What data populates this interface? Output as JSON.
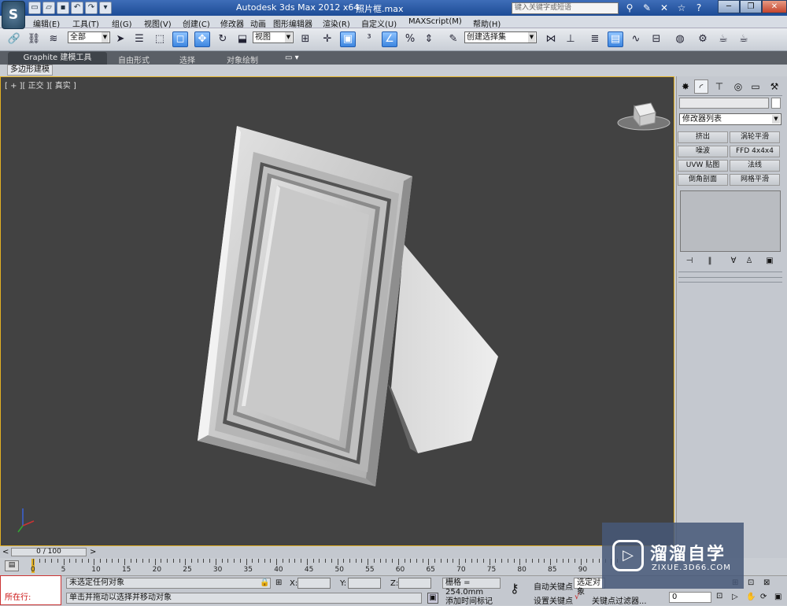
{
  "app": {
    "logo": "S",
    "title": "Autodesk 3ds Max  2012 x64",
    "file": "照片框.max"
  },
  "quick_access": [
    "new-icon",
    "open-icon",
    "save-icon",
    "undo-icon",
    "redo-icon"
  ],
  "search": {
    "placeholder": "键入关键字或短语"
  },
  "menu": [
    "编辑(E)",
    "工具(T)",
    "组(G)",
    "视图(V)",
    "创建(C)",
    "修改器",
    "动画",
    "图形编辑器",
    "渲染(R)",
    "自定义(U)",
    "MAXScript(M)",
    "帮助(H)"
  ],
  "toolbar": {
    "filter": "全部",
    "coord_system": "视图",
    "named_selection": "创建选择集"
  },
  "ribbon": {
    "tabs": [
      "Graphite 建模工具",
      "自由形式",
      "选择",
      "对象绘制"
    ],
    "subtab": "多边形建模"
  },
  "viewport": {
    "label": "[ + ][ 正交 ][ 真实 ]"
  },
  "command_panel": {
    "modifier_list": "修改器列表",
    "buttons": [
      "挤出",
      "涡轮平滑",
      "噪波",
      "FFD 4x4x4",
      "UVW 贴图",
      "法线",
      "倒角剖面",
      "网格平滑"
    ]
  },
  "timeline": {
    "frame": "0 / 100",
    "ticks": [
      "0",
      "5",
      "10",
      "15",
      "20",
      "25",
      "30",
      "35",
      "40",
      "45",
      "50",
      "55",
      "60",
      "65",
      "70",
      "75",
      "80",
      "85",
      "90"
    ]
  },
  "status": {
    "running": "所在行:",
    "selection": "未选定任何对象",
    "prompt": "单击并拖动以选择并移动对象",
    "x_label": "X:",
    "y_label": "Y:",
    "z_label": "Z:",
    "grid": "栅格 = 254.0mm",
    "add_time_tag": "添加时间标记",
    "auto_key": "自动关键点",
    "set_key": "设置关键点",
    "selected_obj": "选定对象",
    "key_filters": "关键点过滤器...",
    "frame_value": "0"
  },
  "watermark": {
    "title": "溜溜自学",
    "subtitle": "ZIXUE.3D66.COM"
  }
}
